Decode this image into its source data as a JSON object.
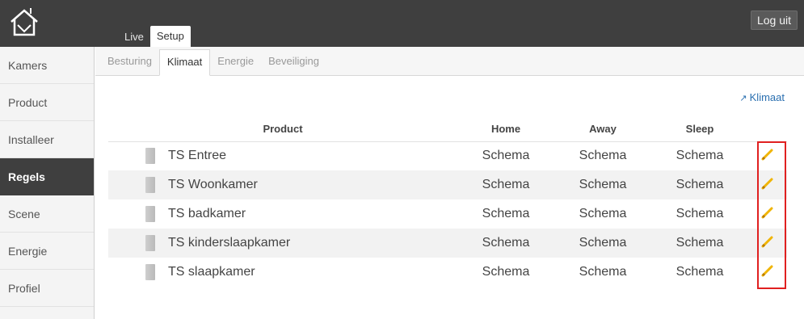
{
  "topbar": {
    "tabs": [
      {
        "label": "Live",
        "active": false
      },
      {
        "label": "Setup",
        "active": true
      }
    ],
    "logout_label": "Log uit"
  },
  "sidebar": {
    "items": [
      {
        "label": "Kamers"
      },
      {
        "label": "Product"
      },
      {
        "label": "Installeer"
      },
      {
        "label": "Regels",
        "active": true
      },
      {
        "label": "Scene"
      },
      {
        "label": "Energie"
      },
      {
        "label": "Profiel"
      }
    ]
  },
  "subtabs": [
    {
      "label": "Besturing"
    },
    {
      "label": "Klimaat",
      "active": true
    },
    {
      "label": "Energie"
    },
    {
      "label": "Beveiliging"
    }
  ],
  "content": {
    "link_label": "Klimaat",
    "columns": [
      "Product",
      "Home",
      "Away",
      "Sleep"
    ],
    "rows": [
      {
        "name": "TS Entree",
        "home": "Schema",
        "away": "Schema",
        "sleep": "Schema"
      },
      {
        "name": "TS Woonkamer",
        "home": "Schema",
        "away": "Schema",
        "sleep": "Schema"
      },
      {
        "name": "TS badkamer",
        "home": "Schema",
        "away": "Schema",
        "sleep": "Schema"
      },
      {
        "name": "TS kinderslaapkamer",
        "home": "Schema",
        "away": "Schema",
        "sleep": "Schema"
      },
      {
        "name": "TS slaapkamer",
        "home": "Schema",
        "away": "Schema",
        "sleep": "Schema"
      }
    ]
  },
  "colors": {
    "topbar": "#3f3f3f",
    "link": "#2a6fb0",
    "highlight": "#e02020",
    "pencil": "#f0b400"
  },
  "icons": {
    "logo": "house-logo-icon",
    "external_link": "external-link-icon",
    "edit": "pencil-icon",
    "device": "thermostat-device-icon"
  }
}
